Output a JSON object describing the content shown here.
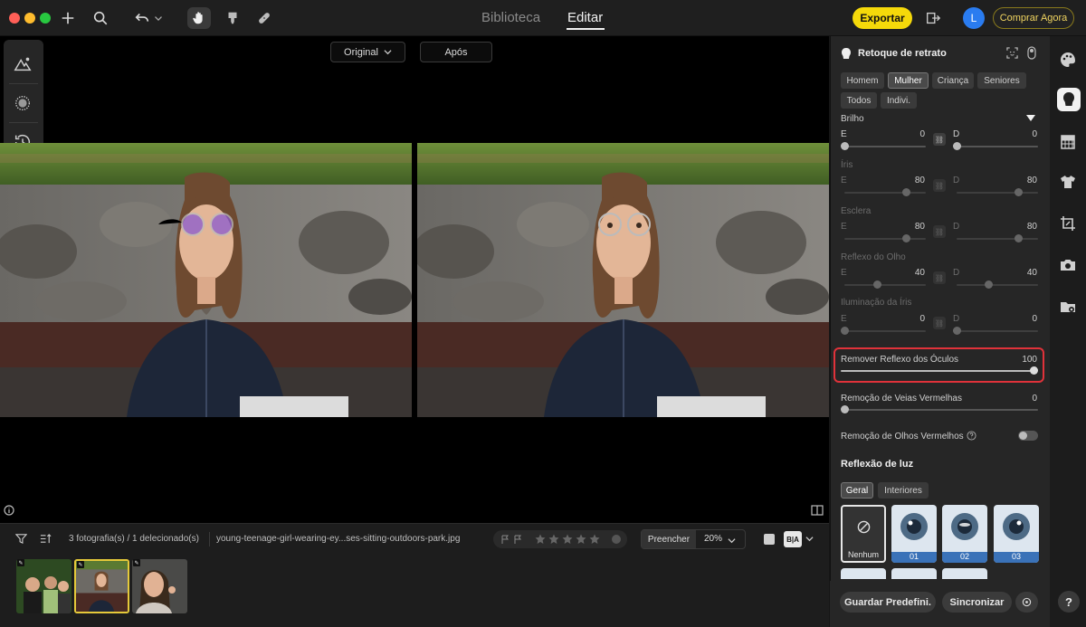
{
  "topbar": {
    "tabs": [
      "Biblioteca",
      "Editar"
    ],
    "active_tab": "Editar",
    "export_label": "Exportar",
    "avatar_letter": "L",
    "buy_label": "Comprar Agora"
  },
  "canvas": {
    "view_select": "Original",
    "after_label": "Após"
  },
  "filmstrip": {
    "count_text": "3 fotografia(s) / 1 delecionado(s)",
    "filename": "young-teenage-girl-wearing-ey...ses-sitting-outdoors-park.jpg",
    "fill_label": "Preencher",
    "zoom": "20%",
    "ba_label": "B|A"
  },
  "panel": {
    "title": "Retoque de retrato",
    "chips_row1": [
      "Homem",
      "Mulher",
      "Criança",
      "Seniores"
    ],
    "chips_row2": [
      "Todos",
      "Indivi."
    ],
    "selected_chip": "Mulher",
    "brightness_label": "Brilho",
    "brightness_e": "0",
    "brightness_d": "0",
    "iris_label": "Íris",
    "iris_e": "80",
    "iris_d": "80",
    "sclera_label": "Esclera",
    "sclera_e": "80",
    "sclera_d": "80",
    "eye_reflex_label": "Reflexo do Olho",
    "eye_reflex_e": "40",
    "eye_reflex_d": "40",
    "iris_light_label": "Iluminação da Íris",
    "iris_light_e": "0",
    "iris_light_d": "0",
    "side_e": "E",
    "side_d": "D",
    "glasses_label": "Remover Reflexo dos Óculos",
    "glasses_value": "100",
    "veins_label": "Remoção de Veias Vermelhas",
    "veins_value": "0",
    "redeye_label": "Remoção de Olhos Vermelhos",
    "light_reflex_title": "Reflexão de luz",
    "light_tabs": [
      "Geral",
      "Interiores"
    ],
    "presets": [
      "Nenhum",
      "01",
      "02",
      "03"
    ],
    "save_preset": "Guardar Predefini.",
    "sync": "Sincronizar"
  },
  "colors": {
    "accent": "#f5d90a",
    "highlight": "#e0323a",
    "avatar": "#2a7cf0"
  }
}
